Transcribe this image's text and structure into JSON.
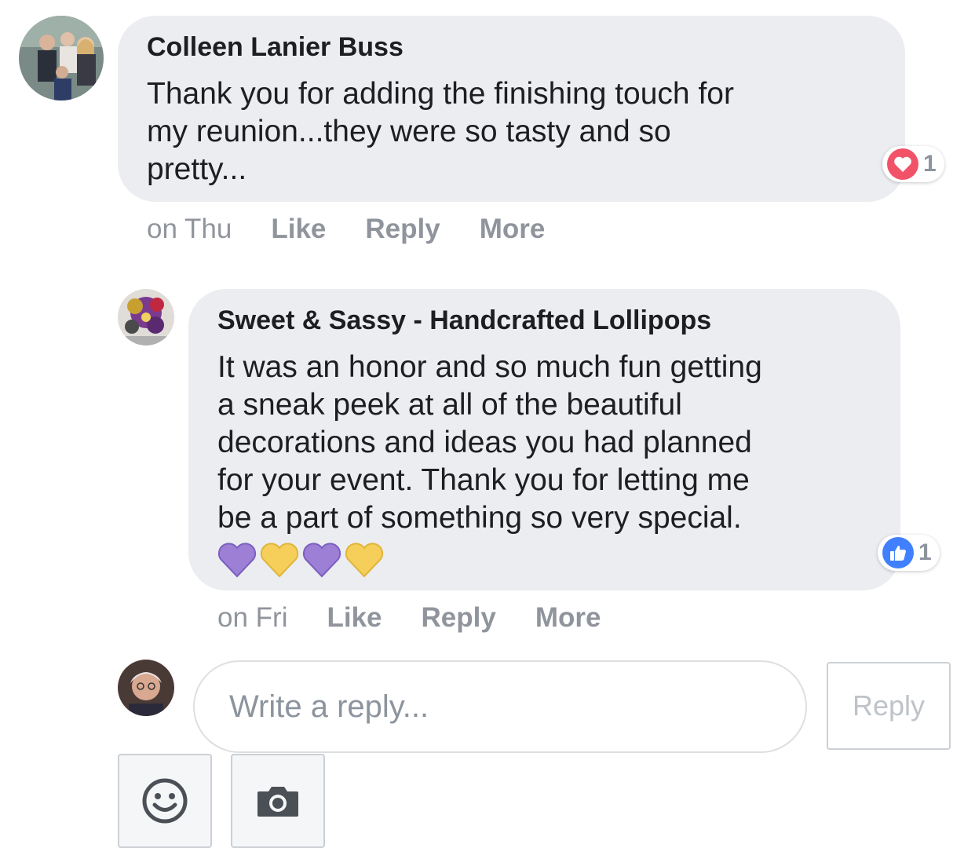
{
  "comments": [
    {
      "author": "Colleen Lanier Buss",
      "text_lines": [
        "Thank you for adding the finishing touch for",
        "my reunion...they were so tasty and so",
        "pretty..."
      ],
      "time": "on Thu",
      "actions": [
        "Like",
        "Reply",
        "More"
      ],
      "reaction": {
        "icon": "heart-icon",
        "count": "1",
        "color": "#f25268"
      }
    },
    {
      "author": "Sweet & Sassy - Handcrafted Lollipops",
      "text_lines": [
        "It was an honor and so much fun getting",
        "a sneak peek at all of the beautiful",
        "decorations and ideas you had planned",
        "for your event. Thank you for letting me",
        "be a part of something so very special."
      ],
      "emoji": [
        "purple-heart",
        "yellow-heart",
        "purple-heart",
        "yellow-heart"
      ],
      "time": "on Fri",
      "actions": [
        "Like",
        "Reply",
        "More"
      ],
      "reaction": {
        "icon": "thumbs-up-icon",
        "count": "1",
        "color": "#4080ff"
      }
    }
  ],
  "composer": {
    "placeholder": "Write a reply...",
    "reply_label": "Reply",
    "tools": [
      "smiley-icon",
      "camera-icon"
    ]
  },
  "colors": {
    "bubble": "#ebedf0",
    "action_text": "#90949c",
    "purple_heart": "#9d80d6",
    "yellow_heart": "#f5cf5a"
  }
}
